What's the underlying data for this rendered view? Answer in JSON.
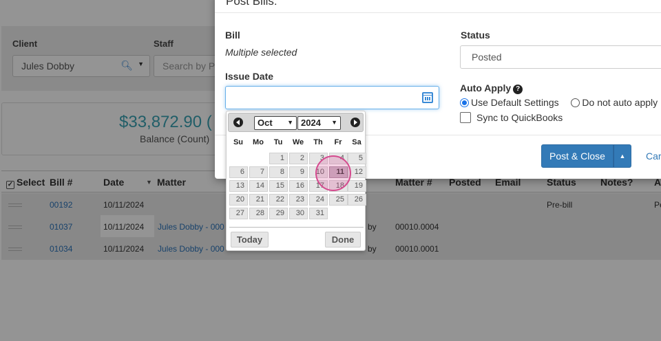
{
  "filters": {
    "client_label": "Client",
    "client_value": "Jules Dobby",
    "staff_label": "Staff",
    "staff_placeholder": "Search by P"
  },
  "balance": {
    "amount": "$33,872.90 (",
    "caption": "Balance (Count)"
  },
  "grid": {
    "headers": {
      "select": "Select",
      "bill_no": "Bill #",
      "date": "Date",
      "matter": "Matter",
      "matter_no": "Matter #",
      "posted": "Posted",
      "email": "Email",
      "status": "Status",
      "notes": "Notes?",
      "a": "A"
    },
    "rows": [
      {
        "bill": "00192",
        "date": "10/11/2024",
        "matter": "",
        "client_tail": "",
        "matter_no": "",
        "status": "Pre-bill",
        "last": "Pe"
      },
      {
        "bill": "01037",
        "date": "10/11/2024",
        "matter": "Jules Dobby - 000",
        "client_tail": "by",
        "matter_no": "00010.0004",
        "status": "",
        "last": ""
      },
      {
        "bill": "01034",
        "date": "10/11/2024",
        "matter": "Jules Dobby - 000",
        "client_tail": "by",
        "matter_no": "00010.0001",
        "status": "",
        "last": ""
      }
    ]
  },
  "modal": {
    "title": "Post Bills:",
    "bill_label": "Bill",
    "bill_value": "Multiple selected",
    "issue_date_label": "Issue Date",
    "issue_date_value": "",
    "status_label": "Status",
    "status_value": "Posted",
    "auto_apply_label": "Auto Apply",
    "radio_default": "Use Default Settings",
    "radio_none": "Do not auto apply",
    "sync_label": "Sync to QuickBooks",
    "post_close_button": "Post & Close",
    "cancel_button": "Car"
  },
  "datepicker": {
    "month": "Oct",
    "year": "2024",
    "weekdays": [
      "Su",
      "Mo",
      "Tu",
      "We",
      "Th",
      "Fr",
      "Sa"
    ],
    "weeks": [
      [
        "",
        "",
        "1",
        "2",
        "3",
        "4",
        "5"
      ],
      [
        "6",
        "7",
        "8",
        "9",
        "10",
        "11",
        "12"
      ],
      [
        "13",
        "14",
        "15",
        "16",
        "17",
        "18",
        "19"
      ],
      [
        "20",
        "21",
        "22",
        "23",
        "24",
        "25",
        "26"
      ],
      [
        "27",
        "28",
        "29",
        "30",
        "31",
        "",
        ""
      ]
    ],
    "selected_day": "11",
    "today_button": "Today",
    "done_button": "Done"
  },
  "colors": {
    "primary": "#337ab7",
    "link": "#2a72b8",
    "balance": "#3aa3b3",
    "click_marker": "#d44a8e"
  }
}
